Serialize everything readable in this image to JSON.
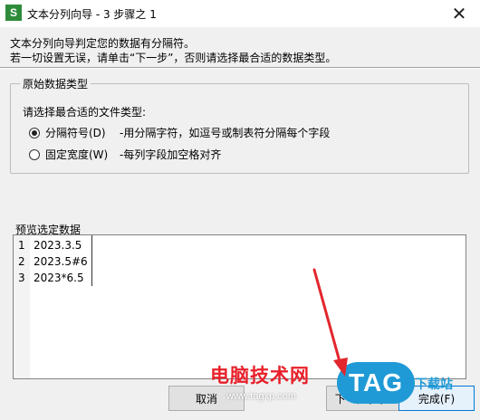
{
  "window": {
    "title": "文本分列向导 - 3 步骤之 1",
    "app_icon_letter": "S",
    "close_glyph": "✕"
  },
  "description": {
    "line1": "文本分列向导判定您的数据有分隔符。",
    "line2": "若一切设置无误，请单击“下一步”，否则请选择最合适的数据类型。"
  },
  "original_data_type": {
    "group_label": "原始数据类型",
    "prompt": "请选择最合适的文件类型:",
    "options": [
      {
        "label": "分隔符号(D)",
        "hint": "-用分隔字符，如逗号或制表符分隔每个字段",
        "checked": true
      },
      {
        "label": "固定宽度(W)",
        "hint": "-每列字段加空格对齐",
        "checked": false
      }
    ]
  },
  "preview": {
    "label": "预览选定数据",
    "rows": [
      {
        "num": "1",
        "value": "2023.3.5"
      },
      {
        "num": "2",
        "value": "2023.5#6"
      },
      {
        "num": "3",
        "value": "2023*6.5"
      }
    ]
  },
  "buttons": {
    "cancel": "取消",
    "next": "下一步(N)>",
    "finish": "完成(F)"
  },
  "watermark": {
    "site_name": "电脑技术网",
    "url": "www.tagxp.com",
    "logo": "TAG",
    "dl_site": "下载站"
  },
  "colors": {
    "arrow": "#e3262d",
    "app_icon": "#2e8b3a",
    "tag_logo": "#1f9ad6"
  }
}
